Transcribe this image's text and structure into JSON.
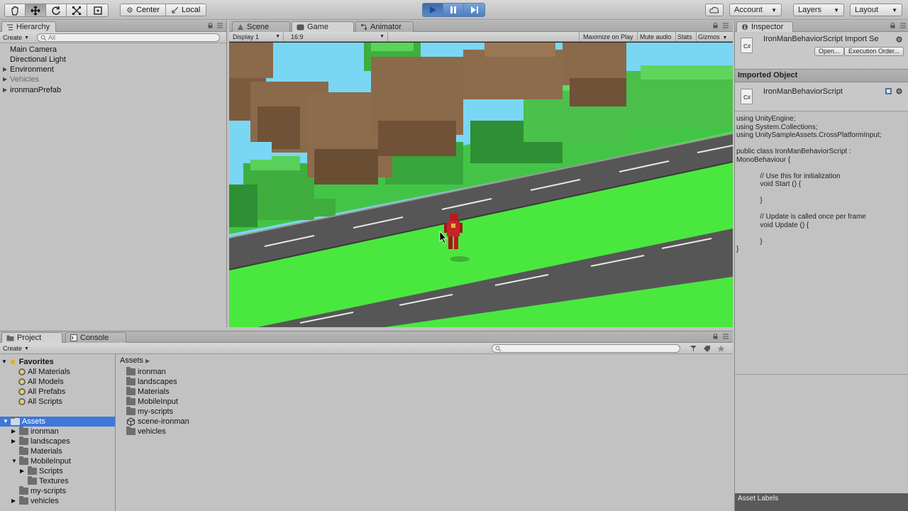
{
  "toolbar": {
    "tools": [
      "hand-tool",
      "move-tool",
      "rotate-tool",
      "scale-tool",
      "rect-tool"
    ],
    "pivot_center": "Center",
    "pivot_local": "Local",
    "account": "Account",
    "layers": "Layers",
    "layout": "Layout"
  },
  "hierarchy": {
    "tab": "Hierarchy",
    "create": "Create",
    "search_placeholder": "All",
    "items": [
      {
        "label": "Main Camera"
      },
      {
        "label": "Directional Light"
      },
      {
        "label": "Environment"
      },
      {
        "label": "Vehicles"
      },
      {
        "label": "ironmanPrefab"
      }
    ]
  },
  "game_view": {
    "tabs": [
      "Scene",
      "Game",
      "Animator"
    ],
    "display": "Display 1",
    "aspect": "16:9",
    "maximize": "Maximize on Play",
    "mute": "Mute audio",
    "stats": "Stats",
    "gizmos": "Gizmos"
  },
  "inspector": {
    "tab": "Inspector",
    "title": "IronManBehaviorScript Import Se",
    "open_btn": "Open...",
    "exec_btn": "Execution Order...",
    "section": "Imported Object",
    "object_name": "IronManBehaviorScript",
    "code": "using UnityEngine;\nusing System.Collections;\nusing UnitySampleAssets.CrossPlatformInput;\n\npublic class IronManBehaviorScript :\nMonoBehaviour {\n\n            // Use this for initialization\n            void Start () {\n\n            }\n\n            // Update is called once per frame\n            void Update () {\n\n            }\n}",
    "asset_labels": "Asset Labels"
  },
  "project": {
    "tabs": [
      "Project",
      "Console"
    ],
    "create": "Create",
    "favorites_label": "Favorites",
    "favorites": [
      "All Materials",
      "All Models",
      "All Prefabs",
      "All Scripts"
    ],
    "assets_label": "Assets",
    "tree": [
      {
        "label": "ironman",
        "level": 1,
        "fold": "▶"
      },
      {
        "label": "landscapes",
        "level": 1,
        "fold": "▶"
      },
      {
        "label": "Materials",
        "level": 1,
        "fold": ""
      },
      {
        "label": "MobileInput",
        "level": 1,
        "fold": "▼"
      },
      {
        "label": "Scripts",
        "level": 2,
        "fold": "▶"
      },
      {
        "label": "Textures",
        "level": 2,
        "fold": ""
      },
      {
        "label": "my-scripts",
        "level": 1,
        "fold": ""
      },
      {
        "label": "vehicles",
        "level": 1,
        "fold": "▶"
      }
    ],
    "breadcrumb": "Assets",
    "list": [
      {
        "label": "ironman",
        "kind": "folder"
      },
      {
        "label": "landscapes",
        "kind": "folder"
      },
      {
        "label": "Materials",
        "kind": "folder"
      },
      {
        "label": "MobileInput",
        "kind": "folder"
      },
      {
        "label": "my-scripts",
        "kind": "folder"
      },
      {
        "label": "scene-ironman",
        "kind": "scene"
      },
      {
        "label": "vehicles",
        "kind": "folder"
      }
    ]
  }
}
